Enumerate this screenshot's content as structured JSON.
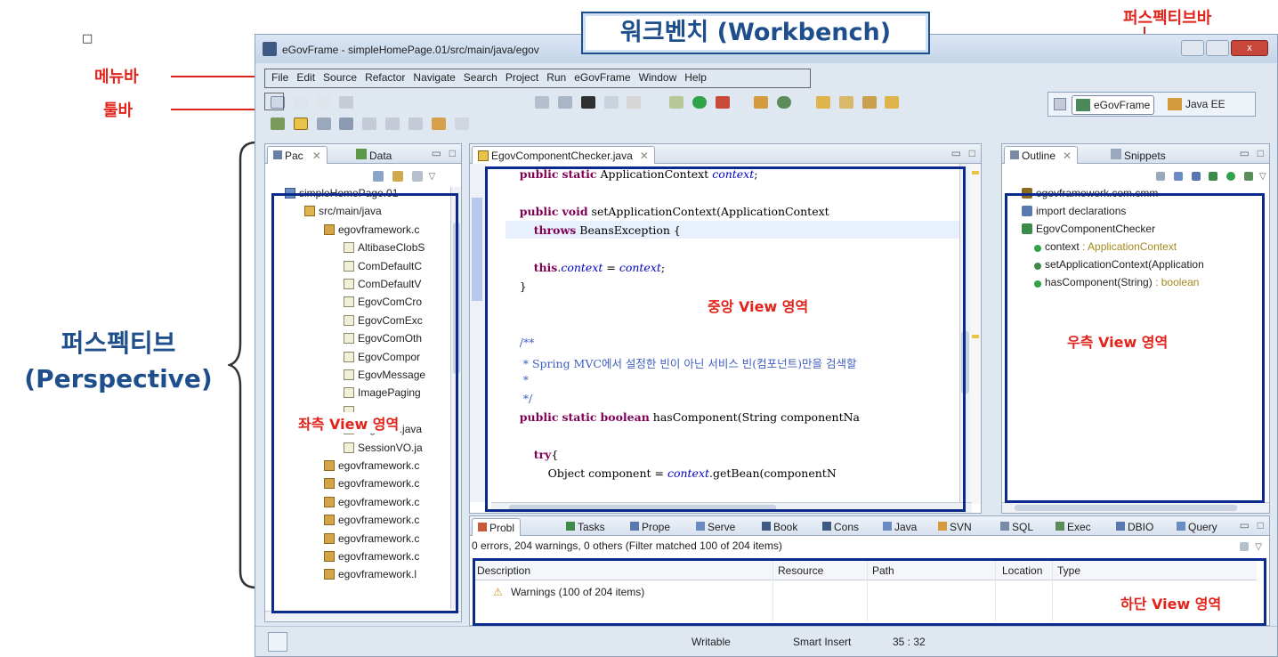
{
  "annotations": {
    "workbench": "워크벤치 (Workbench)",
    "perspective_bar": "퍼스펙티브바",
    "menubar": "메뉴바",
    "toolbar": "툴바",
    "perspective_line1": "퍼스펙티브",
    "perspective_line2": "(Perspective)",
    "left_view": "좌측 View 영역",
    "center_view": "중앙 View 영역",
    "right_view": "우측 View 영역",
    "bottom_view": "하단 View 영역",
    "small_square": "□"
  },
  "window": {
    "title": "eGovFrame - simpleHomePage.01/src/main/java/egov"
  },
  "menu": [
    "File",
    "Edit",
    "Source",
    "Refactor",
    "Navigate",
    "Search",
    "Project",
    "Run",
    "eGovFrame",
    "Window",
    "Help"
  ],
  "perspectives": {
    "egovframe": "eGovFrame",
    "javaee": "Java EE"
  },
  "left_panel": {
    "tab1": "Pac",
    "tab2": "Data",
    "tree": [
      {
        "label": "simpleHomePage.01",
        "icon": "proj",
        "indent": 0
      },
      {
        "label": "src/main/java",
        "icon": "src",
        "indent": 1
      },
      {
        "label": "egovframework.c",
        "icon": "pkg",
        "indent": 2
      },
      {
        "label": "AltibaseClobS",
        "icon": "file",
        "indent": 3
      },
      {
        "label": "ComDefaultC",
        "icon": "file",
        "indent": 3
      },
      {
        "label": "ComDefaultV",
        "icon": "file",
        "indent": 3
      },
      {
        "label": "EgovComCro",
        "icon": "file",
        "indent": 3
      },
      {
        "label": "EgovComExc",
        "icon": "file",
        "indent": 3
      },
      {
        "label": "EgovComOth",
        "icon": "file",
        "indent": 3
      },
      {
        "label": "EgovCompor",
        "icon": "file",
        "indent": 3
      },
      {
        "label": "EgovMessage",
        "icon": "file",
        "indent": 3
      },
      {
        "label": "ImagePaging",
        "icon": "file",
        "indent": 3
      },
      {
        "label": "",
        "icon": "file",
        "indent": 3
      },
      {
        "label": "LoginVO.java",
        "icon": "file",
        "indent": 3
      },
      {
        "label": "SessionVO.ja",
        "icon": "file",
        "indent": 3
      },
      {
        "label": "egovframework.c",
        "icon": "pkg",
        "indent": 2
      },
      {
        "label": "egovframework.c",
        "icon": "pkg",
        "indent": 2
      },
      {
        "label": "egovframework.c",
        "icon": "pkg",
        "indent": 2
      },
      {
        "label": "egovframework.c",
        "icon": "pkg",
        "indent": 2
      },
      {
        "label": "egovframework.c",
        "icon": "pkg",
        "indent": 2
      },
      {
        "label": "egovframework.c",
        "icon": "pkg",
        "indent": 2
      },
      {
        "label": "egovframework.l",
        "icon": "pkg",
        "indent": 2
      }
    ]
  },
  "editor": {
    "tab": "EgovComponentChecker.java",
    "lines": [
      {
        "t": "        public static ApplicationContext context;",
        "k": "sig"
      },
      {
        "t": "",
        "k": "blank"
      },
      {
        "t": "        public void setApplicationContext(ApplicationContext",
        "k": "sig2"
      },
      {
        "t": "            throws BeansException {",
        "k": "throws"
      },
      {
        "t": "",
        "k": "blank"
      },
      {
        "t": "            this.context = context;",
        "k": "this"
      },
      {
        "t": "        }",
        "k": "plain"
      },
      {
        "t": "",
        "k": "blank"
      },
      {
        "t": "",
        "k": "blank"
      },
      {
        "t": "        /**",
        "k": "cmt"
      },
      {
        "t": "         * Spring MVC에서 설정한 빈이 아닌 서비스 빈(컴포넌트)만을 검색할",
        "k": "cmt"
      },
      {
        "t": "         *",
        "k": "cmt"
      },
      {
        "t": "         */",
        "k": "cmt"
      },
      {
        "t": "        public static boolean hasComponent(String componentNa",
        "k": "sig3"
      },
      {
        "t": "",
        "k": "blank"
      },
      {
        "t": "            try{",
        "k": "try"
      },
      {
        "t": "                Object component = context.getBean(componentN",
        "k": "obj"
      }
    ]
  },
  "outline": {
    "tab1": "Outline",
    "tab2": "Snippets",
    "items": [
      {
        "label": "egovframework.com.cmm",
        "type": "",
        "indent": 0
      },
      {
        "label": "import declarations",
        "type": "",
        "indent": 0
      },
      {
        "label": "EgovComponentChecker",
        "type": "",
        "indent": 0
      },
      {
        "label": "context",
        "type": " : ApplicationContext",
        "indent": 1
      },
      {
        "label": "setApplicationContext(Application",
        "type": "",
        "indent": 1
      },
      {
        "label": "hasComponent(String)",
        "type": " : boolean",
        "indent": 1
      }
    ]
  },
  "bottom": {
    "tabs": [
      "Probl",
      "Tasks",
      "Prope",
      "Serve",
      "Book",
      "Cons",
      "Java",
      "SVN",
      "SQL",
      "Exec",
      "DBIO",
      "Query"
    ],
    "summary": "0 errors, 204 warnings, 0 others (Filter matched 100 of 204 items)",
    "columns": [
      "Description",
      "Resource",
      "Path",
      "Location",
      "Type"
    ],
    "row": "Warnings (100 of 204 items)"
  },
  "status": {
    "writable": "Writable",
    "insert": "Smart Insert",
    "position": "35 : 32"
  },
  "colors": {
    "annotation_red": "#e0231b",
    "annotation_blue": "#1f4e8c",
    "box_blue": "#0a2a8c"
  }
}
